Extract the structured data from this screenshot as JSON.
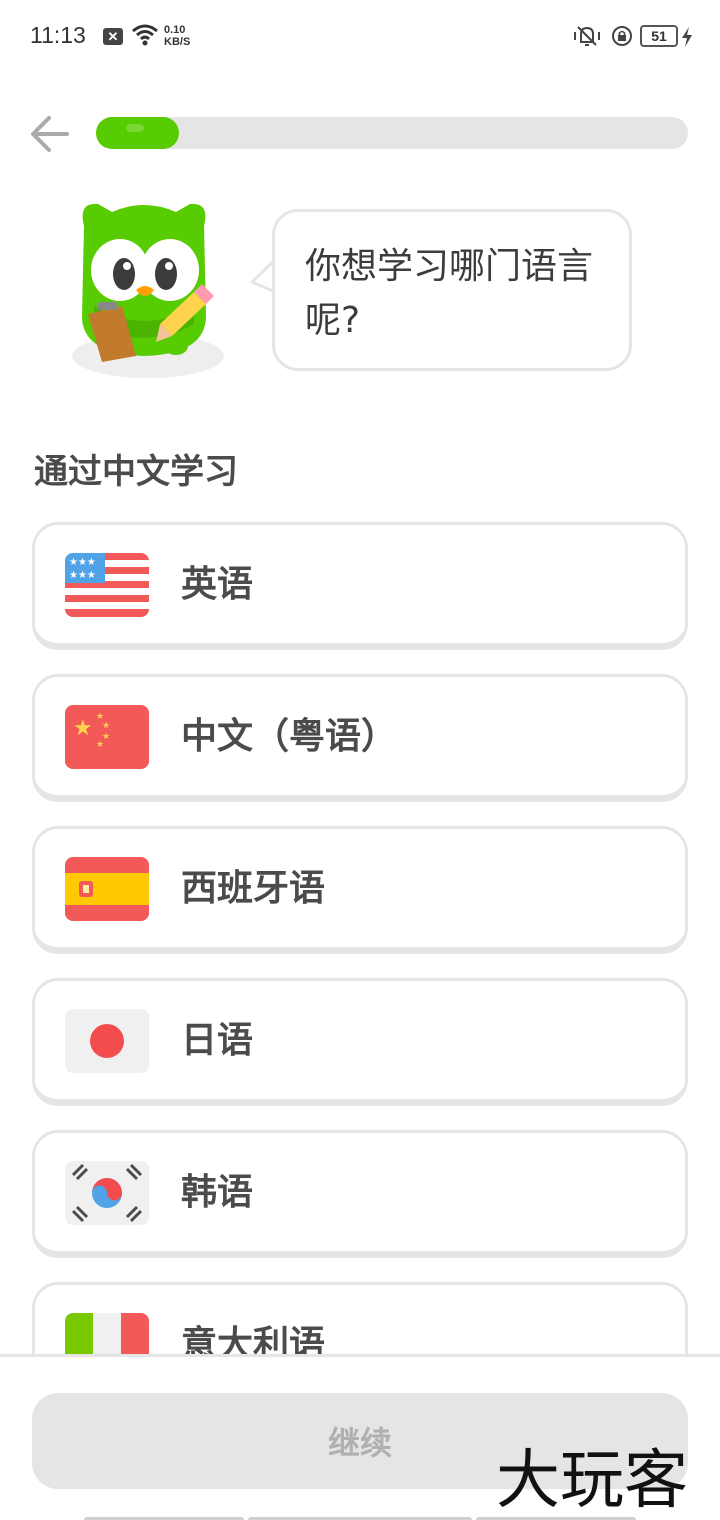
{
  "status_bar": {
    "time": "11:13",
    "net_speed_value": "0.10",
    "net_speed_unit": "KB/S",
    "battery": "51"
  },
  "progress": {
    "fraction": 0.14,
    "color": "#58cc02"
  },
  "speech_bubble": {
    "text": "你想学习哪门语言呢?"
  },
  "section": {
    "title": "通过中文学习"
  },
  "languages": [
    {
      "label": "英语",
      "flag": "us-flag"
    },
    {
      "label": "中文（粤语）",
      "flag": "china-flag"
    },
    {
      "label": "西班牙语",
      "flag": "spain-flag"
    },
    {
      "label": "日语",
      "flag": "japan-flag"
    },
    {
      "label": "韩语",
      "flag": "korea-flag"
    },
    {
      "label": "意大利语",
      "flag": "italy-flag"
    }
  ],
  "footer": {
    "continue_label": "继续"
  },
  "watermark": {
    "text": "大玩客"
  },
  "colors": {
    "brand_green": "#58cc02",
    "border_gray": "#e5e5e5",
    "text_dark": "#4b4b4b"
  }
}
